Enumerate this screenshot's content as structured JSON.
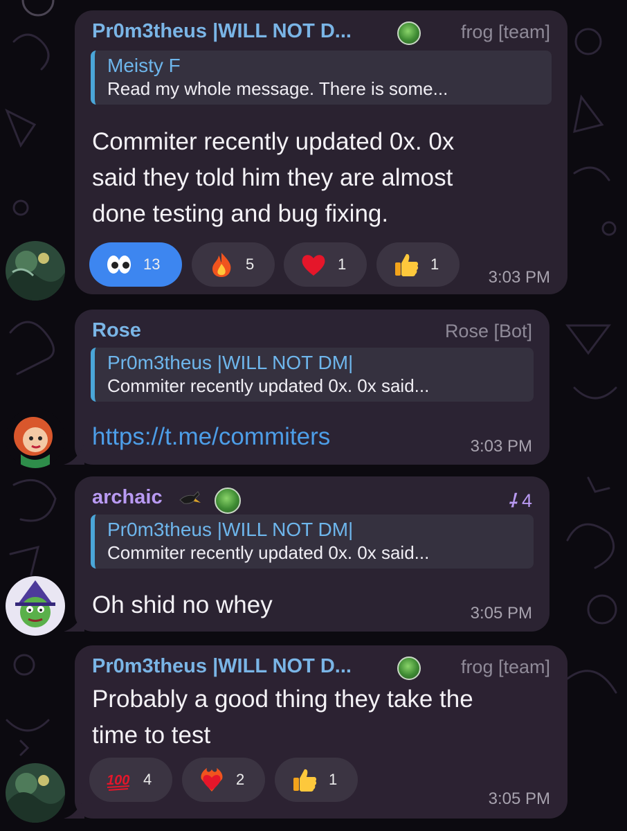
{
  "messages": [
    {
      "sender": "Pr0m3theus |WILL NOT D...",
      "role": "frog [team]",
      "reply": {
        "name": "Meisty F",
        "text": "Read my whole message. There is some..."
      },
      "lines": [
        "Commiter recently updated 0x. 0x",
        "said they told him they are almost",
        "done testing and bug fixing."
      ],
      "reactions": [
        {
          "emoji": "eyes-emoji",
          "count": "13"
        },
        {
          "emoji": "fire-emoji",
          "count": "5"
        },
        {
          "emoji": "heart-emoji",
          "count": "1"
        },
        {
          "emoji": "thumbs-up-emoji",
          "count": "1"
        }
      ],
      "time": "3:03 PM"
    },
    {
      "sender": "Rose",
      "role": "Rose [Bot]",
      "reply": {
        "name": "Pr0m3theus |WILL NOT DM|",
        "text": "Commiter recently updated 0x. 0x said..."
      },
      "link": "https://t.me/commiters",
      "time": "3:03 PM"
    },
    {
      "sender": "archaic",
      "forward_count": "4",
      "reply": {
        "name": "Pr0m3theus |WILL NOT DM|",
        "text": "Commiter recently updated 0x. 0x said..."
      },
      "text": "Oh shid no whey",
      "time": "3:05 PM"
    },
    {
      "sender": "Pr0m3theus |WILL NOT D...",
      "role": "frog [team]",
      "lines": [
        "Probably a good thing they take the",
        "time to test"
      ],
      "reactions": [
        {
          "emoji": "hundred-emoji",
          "count": "4"
        },
        {
          "emoji": "heart-on-fire-emoji",
          "count": "2"
        },
        {
          "emoji": "thumbs-up-emoji",
          "count": "1"
        }
      ],
      "time": "3:05 PM"
    }
  ],
  "colors": {
    "accent": "#3d86f0",
    "sender_blue": "#7ab5e6",
    "sender_purple": "#b99af2",
    "link": "#4d9ee8"
  }
}
